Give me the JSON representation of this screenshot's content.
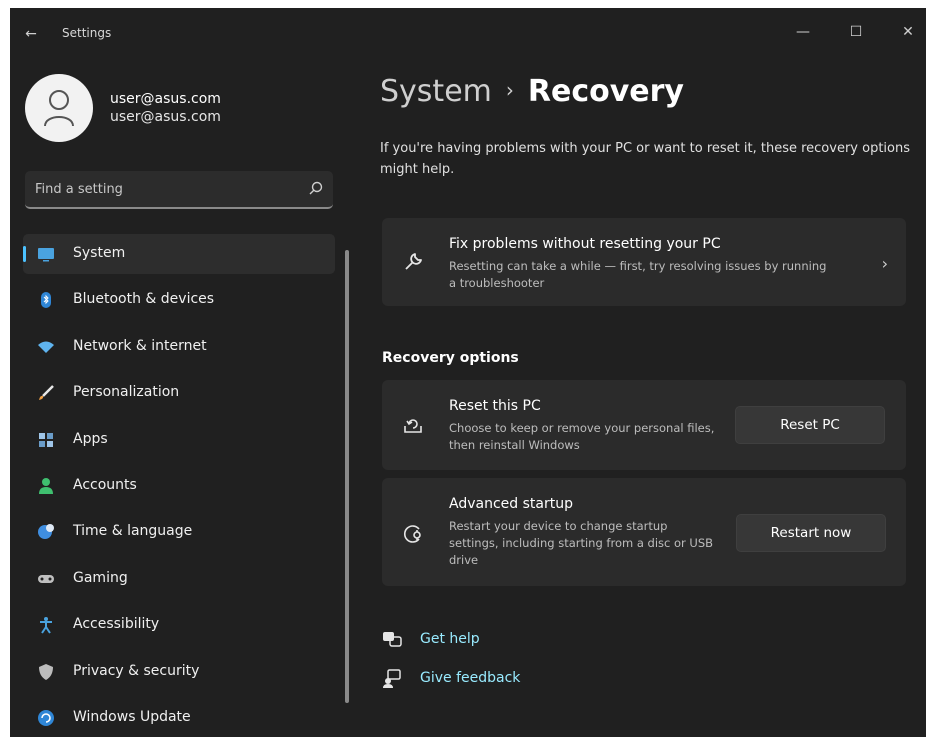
{
  "window": {
    "title": "Settings",
    "back_glyph": "←",
    "minimize_glyph": "—",
    "maximize_glyph": "☐",
    "close_glyph": "✕"
  },
  "profile": {
    "name": "user@asus.com",
    "email": "user@asus.com"
  },
  "search": {
    "placeholder": "Find a setting",
    "icon": "search-icon"
  },
  "nav": {
    "items": [
      {
        "label": "System",
        "icon": "display-icon",
        "active": true
      },
      {
        "label": "Bluetooth & devices",
        "icon": "bluetooth-icon"
      },
      {
        "label": "Network & internet",
        "icon": "wifi-icon"
      },
      {
        "label": "Personalization",
        "icon": "brush-icon"
      },
      {
        "label": "Apps",
        "icon": "apps-icon"
      },
      {
        "label": "Accounts",
        "icon": "person-icon"
      },
      {
        "label": "Time & language",
        "icon": "globe-clock-icon"
      },
      {
        "label": "Gaming",
        "icon": "gamepad-icon"
      },
      {
        "label": "Accessibility",
        "icon": "accessibility-icon"
      },
      {
        "label": "Privacy & security",
        "icon": "shield-icon"
      },
      {
        "label": "Windows Update",
        "icon": "update-icon"
      }
    ]
  },
  "main": {
    "breadcrumb_parent": "System",
    "breadcrumb_sep": "›",
    "breadcrumb_current": "Recovery",
    "intro": "If you're having problems with your PC or want to reset it, these recovery options might help.",
    "fix_card": {
      "title": "Fix problems without resetting your PC",
      "desc": "Resetting can take a while — first, try resolving issues by running a troubleshooter",
      "chevron": "›",
      "icon": "wrench-icon"
    },
    "section_title": "Recovery options",
    "reset_card": {
      "title": "Reset this PC",
      "desc": "Choose to keep or remove your personal files, then reinstall Windows",
      "button": "Reset PC",
      "icon": "reset-pc-icon"
    },
    "advanced_card": {
      "title": "Advanced startup",
      "desc": "Restart your device to change startup settings, including starting from a disc or USB drive",
      "button": "Restart now",
      "icon": "advanced-startup-icon"
    },
    "links": {
      "help": "Get help",
      "feedback": "Give feedback"
    }
  },
  "colors": {
    "background": "#202020",
    "card": "#2b2b2b",
    "accent": "#4cc2ff",
    "link": "#99ebff"
  }
}
